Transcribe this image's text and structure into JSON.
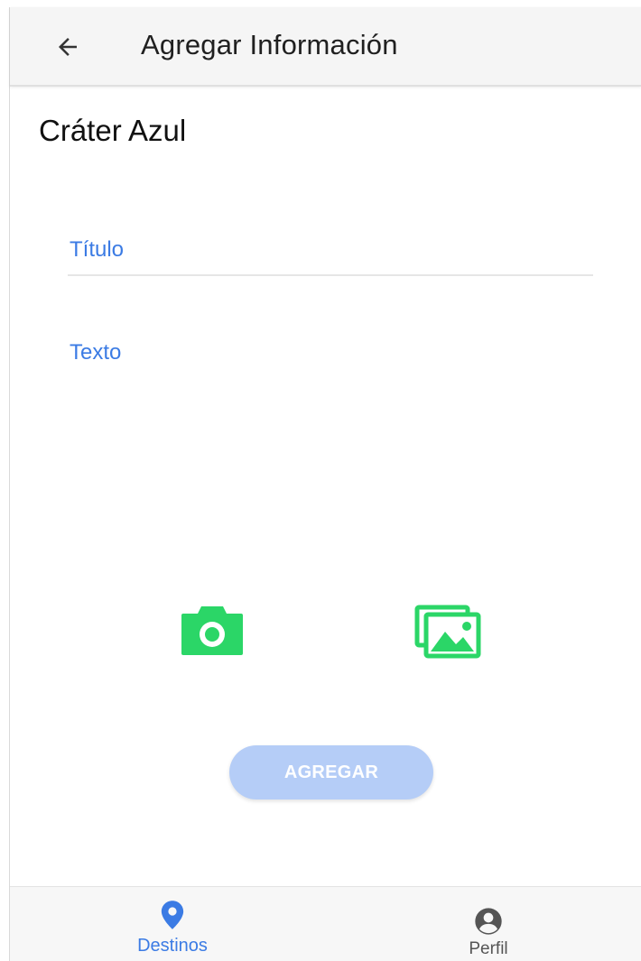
{
  "header": {
    "title": "Agregar Información",
    "back_icon": "arrow-back-icon"
  },
  "place": {
    "name": "Cráter Azul"
  },
  "form": {
    "titulo_label": "Título",
    "texto_label": "Texto",
    "camera_icon": "camera-icon",
    "gallery_icon": "image-gallery-icon",
    "submit_label": "AGREGAR"
  },
  "bottom_nav": {
    "items": [
      {
        "label": "Destinos",
        "icon": "location-pin-icon",
        "active": true
      },
      {
        "label": "Perfil",
        "icon": "account-circle-icon",
        "active": false
      }
    ]
  },
  "colors": {
    "accent": "#3b7be4",
    "icon_green": "#2bd667",
    "button_disabled": "#b5cdf7",
    "app_bar": "#f5f5f5"
  }
}
